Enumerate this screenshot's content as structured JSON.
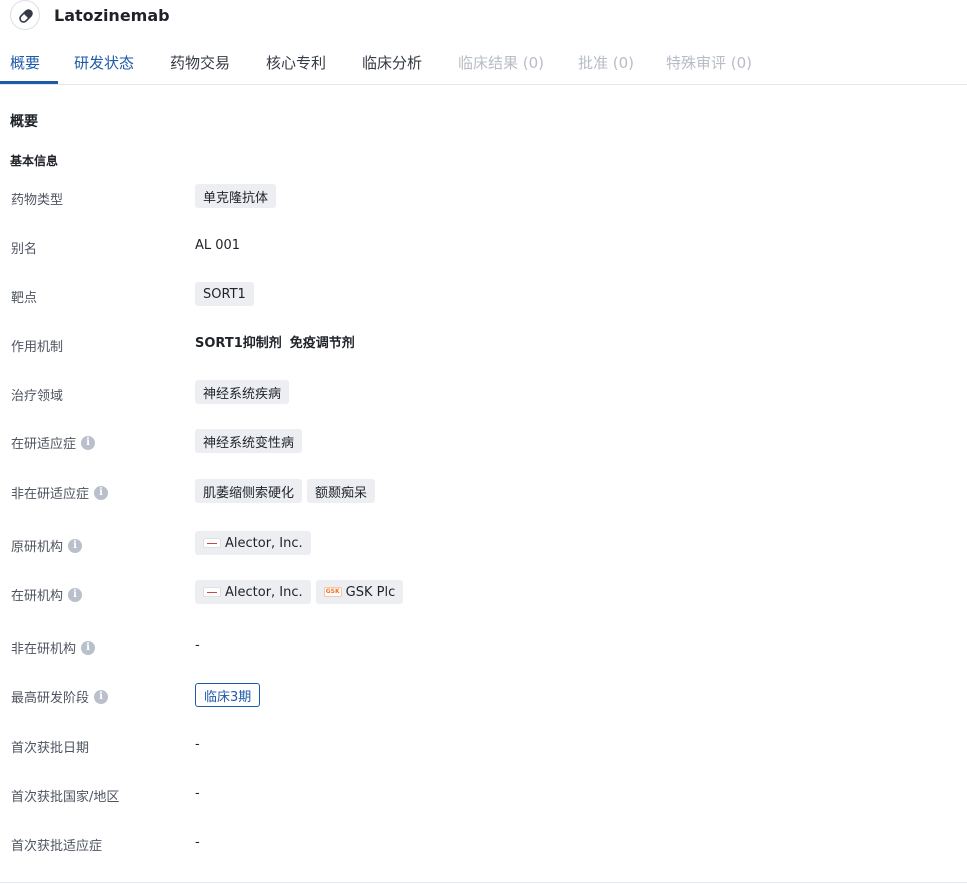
{
  "header": {
    "drug_name": "Latozinemab"
  },
  "tabs": [
    {
      "label": "概要",
      "state": "active"
    },
    {
      "label": "研发状态",
      "state": "link"
    },
    {
      "label": "药物交易",
      "state": "normal"
    },
    {
      "label": "核心专利",
      "state": "normal"
    },
    {
      "label": "临床分析",
      "state": "normal"
    },
    {
      "label": "临床结果 (0)",
      "state": "disabled"
    },
    {
      "label": "批准 (0)",
      "state": "disabled"
    },
    {
      "label": "特殊审评 (0)",
      "state": "disabled"
    }
  ],
  "section_title": "概要",
  "group_title": "基本信息",
  "fields": {
    "drug_type": {
      "label": "药物类型",
      "values": [
        "单克隆抗体"
      ]
    },
    "alias": {
      "label": "别名",
      "value": "AL 001"
    },
    "target": {
      "label": "靶点",
      "values": [
        "SORT1"
      ]
    },
    "mechanism": {
      "label": "作用机制",
      "values": [
        "SORT1抑制剂",
        "免疫调节剂"
      ]
    },
    "therapeutic_area": {
      "label": "治疗领域",
      "values": [
        "神经系统疾病"
      ]
    },
    "active_indication": {
      "label": "在研适应症",
      "values": [
        "神经系统变性病"
      ]
    },
    "inactive_indication": {
      "label": "非在研适应症",
      "values": [
        "肌萎缩侧索硬化",
        "额颞痴呆"
      ]
    },
    "originator": {
      "label": "原研机构",
      "values": [
        "Alector, Inc."
      ]
    },
    "active_org": {
      "label": "在研机构",
      "values": [
        "Alector, Inc.",
        "GSK Plc"
      ]
    },
    "inactive_org": {
      "label": "非在研机构",
      "value": "-"
    },
    "highest_phase": {
      "label": "最高研发阶段",
      "value": "临床3期"
    },
    "first_approval_date": {
      "label": "首次获批日期",
      "value": "-"
    },
    "first_approval_country": {
      "label": "首次获批国家/地区",
      "value": "-"
    },
    "first_approval_indication": {
      "label": "首次获批适应症",
      "value": "-"
    }
  },
  "colors": {
    "accent": "#1f5aa8",
    "disabled_tab": "#b7bcc6",
    "tag_bg": "#eceef2"
  },
  "icons": {
    "drug": "pill-icon",
    "info": "info-icon"
  },
  "logos": {
    "gsk_text": "GSK"
  }
}
